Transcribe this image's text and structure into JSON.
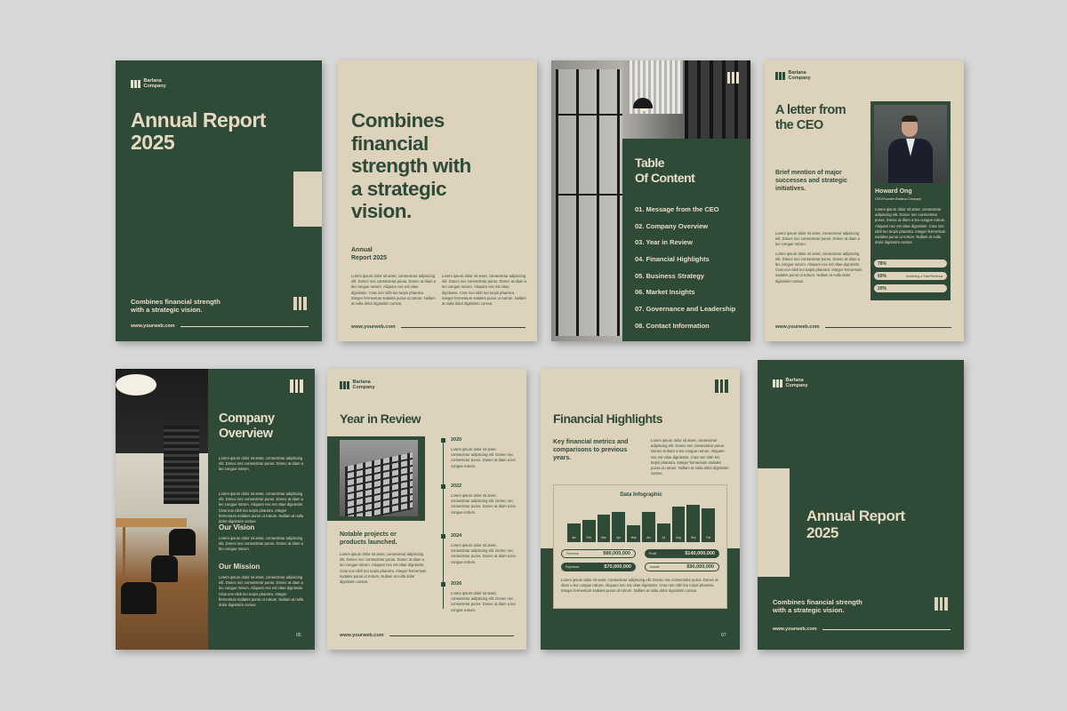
{
  "brand": {
    "line1": "Barlana",
    "line2": "Company"
  },
  "footer_url": "www.yourweb.com",
  "lorem": "Lorem ipsum dolor sit amet, consectetur adipiscing elit. Donec nec consectetur purus. Donec at diam a leo congue rutrum. Aliquam nec est vitae dignissim. Cras non nibh leo turpis pharetra. Integer fermentum sodales purus ut rutrum. Nullam at nulla dolor dignissim cursus.",
  "lorem_short": "Lorem ipsum dolor sit amet, consectetur adipiscing elit. Donec nec consectetur purus. Donec at diam a leo congue rutrum.",
  "cover": {
    "title_1": "Annual Report",
    "title_2": "2025",
    "tagline_1": "Combines financial strength",
    "tagline_2": "with a strategic vision."
  },
  "intro": {
    "heading_1": "Combines",
    "heading_2": "financial",
    "heading_3": "strength with",
    "heading_4": "a strategic",
    "heading_5": "vision.",
    "sub_1": "Annual",
    "sub_2": "Report 2025"
  },
  "toc": {
    "title_1": "Table",
    "title_2": "Of Content",
    "items": [
      "01. Message from the CEO",
      "02. Company Overview",
      "03. Year in Review",
      "04. Financial Highlights",
      "05. Business Strategy",
      "06. Market Insights",
      "07. Governance and Leadership",
      "08. Contact Information"
    ]
  },
  "ceo": {
    "title_1": "A letter from",
    "title_2": "the CEO",
    "sub_1": "Brief mention of major",
    "sub_2": "successes and strategic",
    "sub_3": "initiatives.",
    "name": "Howard Ong",
    "role": "CEO/Founder Barlana Company",
    "stats": [
      {
        "value": "78%",
        "note": ""
      },
      {
        "value": "60%",
        "note": "Achieving a Total Revenue"
      },
      {
        "value": "20%",
        "note": ""
      }
    ]
  },
  "overview": {
    "title_1": "Company",
    "title_2": "Overview",
    "vision": "Our Vision",
    "mission": "Our Mission",
    "page": "05"
  },
  "review": {
    "title": "Year in Review",
    "caption_1": "Notable projects or",
    "caption_2": "products launched.",
    "years": [
      "2020",
      "2022",
      "2024",
      "2026"
    ]
  },
  "financial": {
    "title": "Financial Highlights",
    "sub_1": "Key financial metrics and",
    "sub_2": "comparisons to previous",
    "sub_3": "years.",
    "page": "07",
    "boxes": [
      {
        "key": "Revenue",
        "value": "$80,000,000"
      },
      {
        "key": "Profit",
        "value": "$140,000,000"
      },
      {
        "key": "Expenses",
        "value": "$70,000,000"
      },
      {
        "key": "Assets",
        "value": "$90,000,000"
      }
    ]
  },
  "chart_data": {
    "type": "bar",
    "title": "Data Infographic",
    "categories": [
      "Jan",
      "Feb",
      "Mar",
      "Apr",
      "May",
      "Jun",
      "Jul",
      "Aug",
      "Sep",
      "Oct"
    ],
    "values": [
      50,
      60,
      75,
      80,
      45,
      80,
      50,
      95,
      100,
      90
    ],
    "ylim": [
      0,
      100
    ],
    "grid": false
  },
  "back_cover": {
    "title_1": "Annual Report",
    "title_2": "2025",
    "tagline_1": "Combines financial strength",
    "tagline_2": "with a strategic vision."
  },
  "colors": {
    "dark_green": "#2f4a37",
    "beige": "#ddd2bc",
    "background": "#d8d8d8"
  }
}
